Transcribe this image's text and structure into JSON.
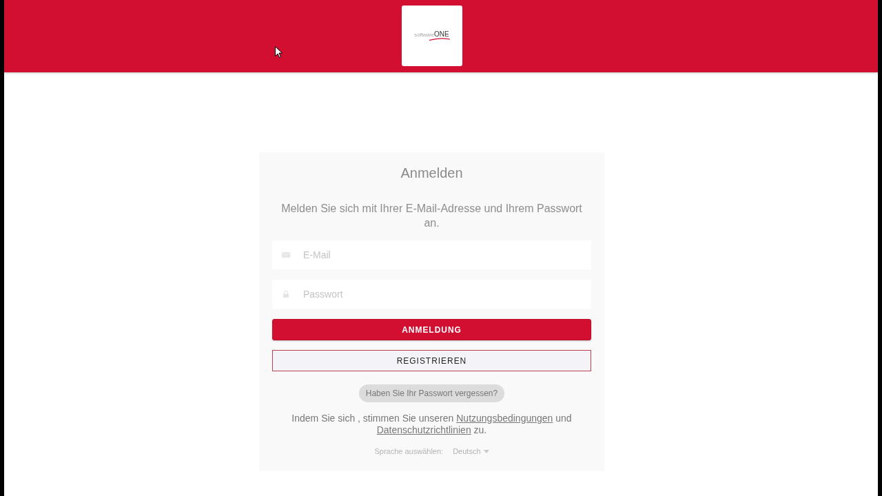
{
  "header": {
    "logo": "software**ONE**"
  },
  "login": {
    "title": "Anmelden",
    "subtitle": "Melden Sie sich mit Ihrer E-Mail-Adresse und Ihrem Passwort an.",
    "fields": [
      {
        "kind": "email",
        "placeholder": "E-Mail"
      },
      {
        "kind": "password",
        "placeholder": "Passwort"
      }
    ],
    "buttons": [
      {
        "kind": "primary",
        "label": "ANMELDUNG"
      },
      {
        "kind": "outline",
        "label": "REGISTRIEREN"
      }
    ],
    "forgot_link": "Haben Sie Ihr Passwort vergessen?",
    "terms": [
      {
        "kind": "text",
        "text": "Indem Sie sich , stimmen Sie unseren "
      },
      {
        "kind": "link",
        "text": "Nutzungsbedingungen"
      },
      {
        "kind": "text",
        "text": " und "
      },
      {
        "kind": "link",
        "text": "Datenschutzrichtlinien"
      },
      {
        "kind": "text",
        "text": " zu."
      }
    ],
    "language": {
      "label": "Sprache auswählen:",
      "value": "Deutsch"
    }
  }
}
